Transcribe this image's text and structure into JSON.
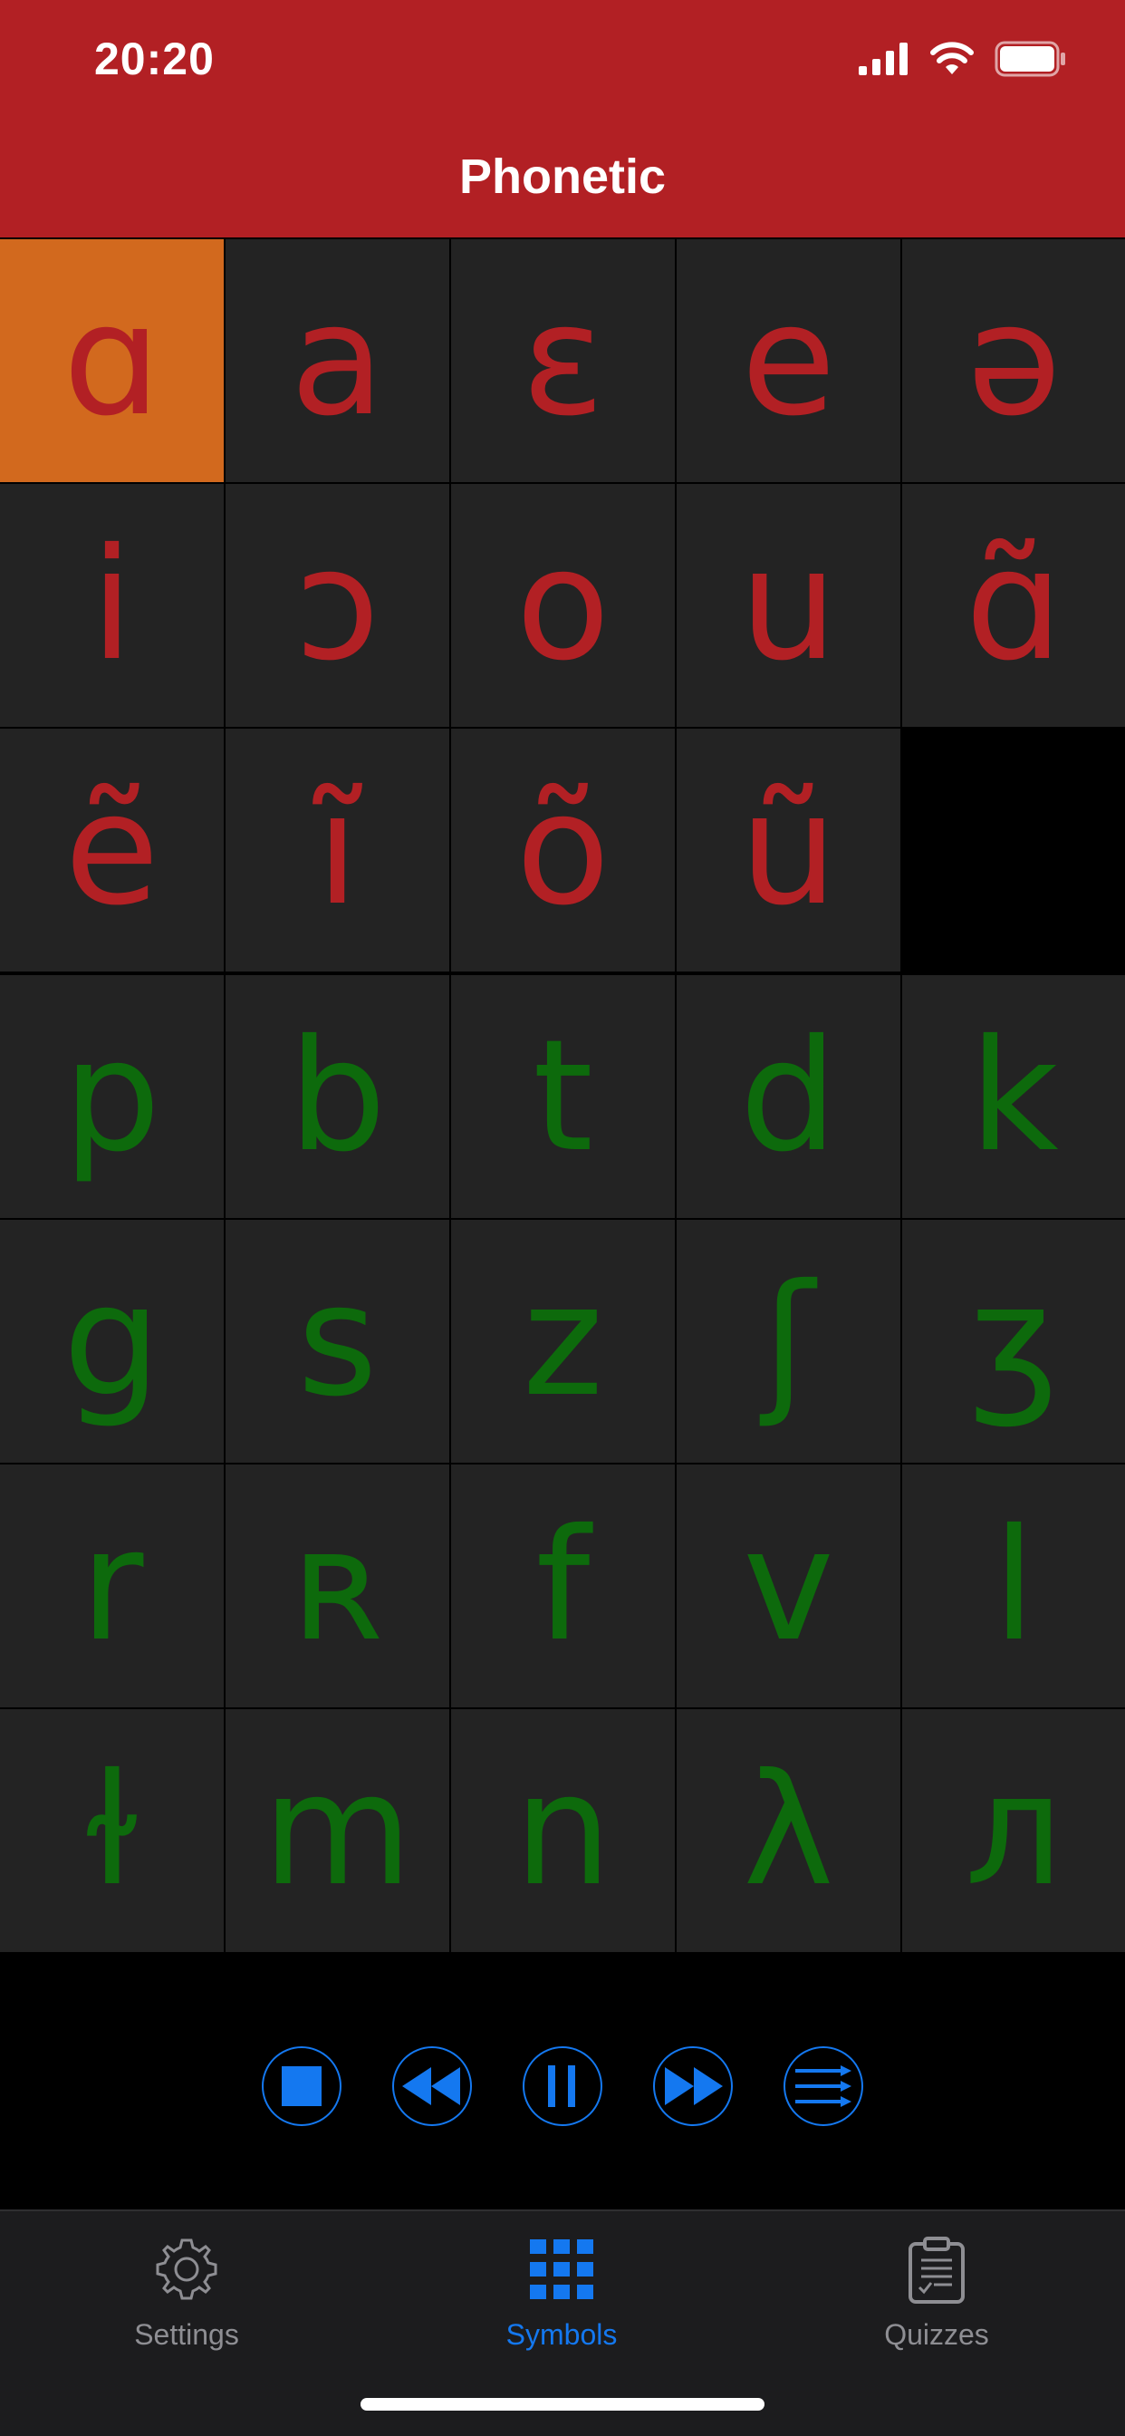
{
  "status_bar": {
    "time": "20:20",
    "icons": [
      "cellular-signal-icon",
      "wifi-icon",
      "battery-icon"
    ]
  },
  "nav": {
    "title": "Phonetic"
  },
  "colors": {
    "header_bg": "#B22024",
    "vowel": "#B22024",
    "consonant": "#0D6A0C",
    "selected": "#D2691E",
    "accent": "#1478F0"
  },
  "grid": {
    "selected_symbol": "ɑ",
    "vowels": [
      [
        "ɑ",
        "a",
        "ɛ",
        "e",
        "ə"
      ],
      [
        "i",
        "ɔ",
        "o",
        "u",
        "ɑ̃"
      ],
      [
        "ẽ",
        "ĩ",
        "õ",
        "ũ",
        ""
      ]
    ],
    "consonants": [
      [
        "p",
        "b",
        "t",
        "d",
        "k"
      ],
      [
        "g",
        "s",
        "z",
        "ʃ",
        "ʒ"
      ],
      [
        "r",
        "ʀ",
        "f",
        "v",
        "l"
      ],
      [
        "ɫ",
        "m",
        "n",
        "λ",
        "л"
      ]
    ]
  },
  "player": {
    "buttons": [
      "stop-icon",
      "rewind-icon",
      "pause-icon",
      "fast-forward-icon",
      "playlist-icon"
    ]
  },
  "tabbar": {
    "settings_label": "Settings",
    "symbols_label": "Symbols",
    "quizzes_label": "Quizzes",
    "active_tab": "Symbols"
  }
}
